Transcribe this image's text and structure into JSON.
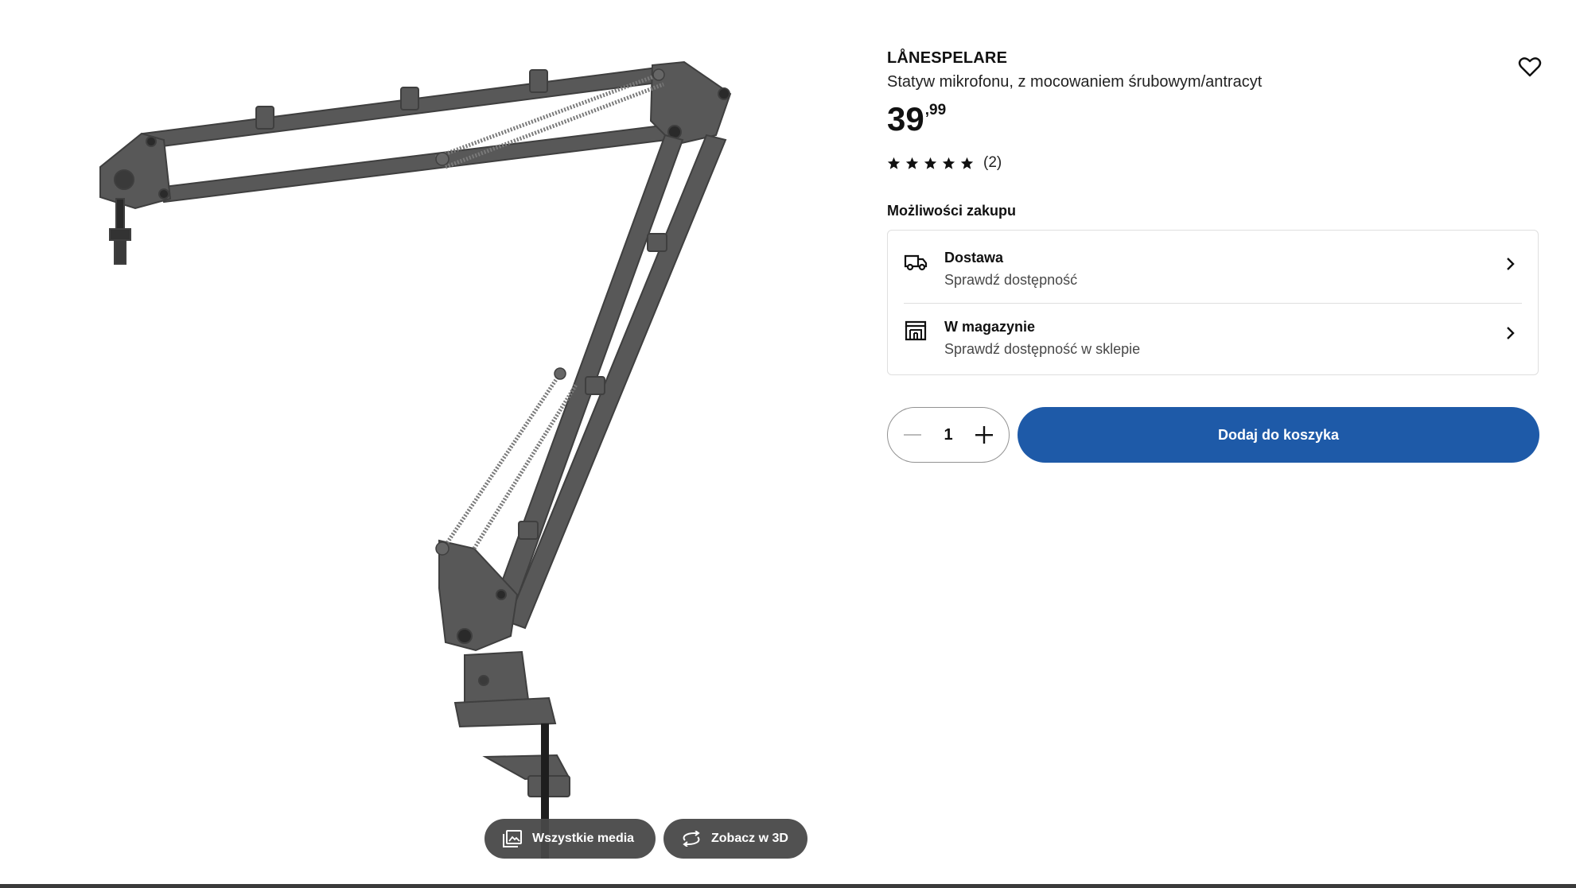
{
  "product": {
    "brand": "LÅNESPELARE",
    "description": "Statyw mikrofonu, z mocowaniem śrubowym/antracyt",
    "price_integer": "39",
    "price_decimal": ",99",
    "rating_value": 5,
    "rating_count": "(2)"
  },
  "gallery": {
    "all_media_label": "Wszystkie media",
    "view_3d_label": "Zobacz w 3D"
  },
  "purchase": {
    "section_title": "Możliwości zakupu",
    "delivery": {
      "title": "Dostawa",
      "subtitle": "Sprawdź dostępność"
    },
    "store": {
      "title": "W magazynie",
      "subtitle": "Sprawdź dostępność w sklepie"
    }
  },
  "cart": {
    "quantity": "1",
    "add_label": "Dodaj do koszyka"
  },
  "colors": {
    "accent": "#1e5aa8",
    "product": "#555555"
  },
  "icons": [
    "heart-icon",
    "star-icon",
    "truck-icon",
    "store-icon",
    "chevron-right-icon",
    "minus-icon",
    "plus-icon",
    "gallery-icon",
    "rotate-3d-icon"
  ]
}
